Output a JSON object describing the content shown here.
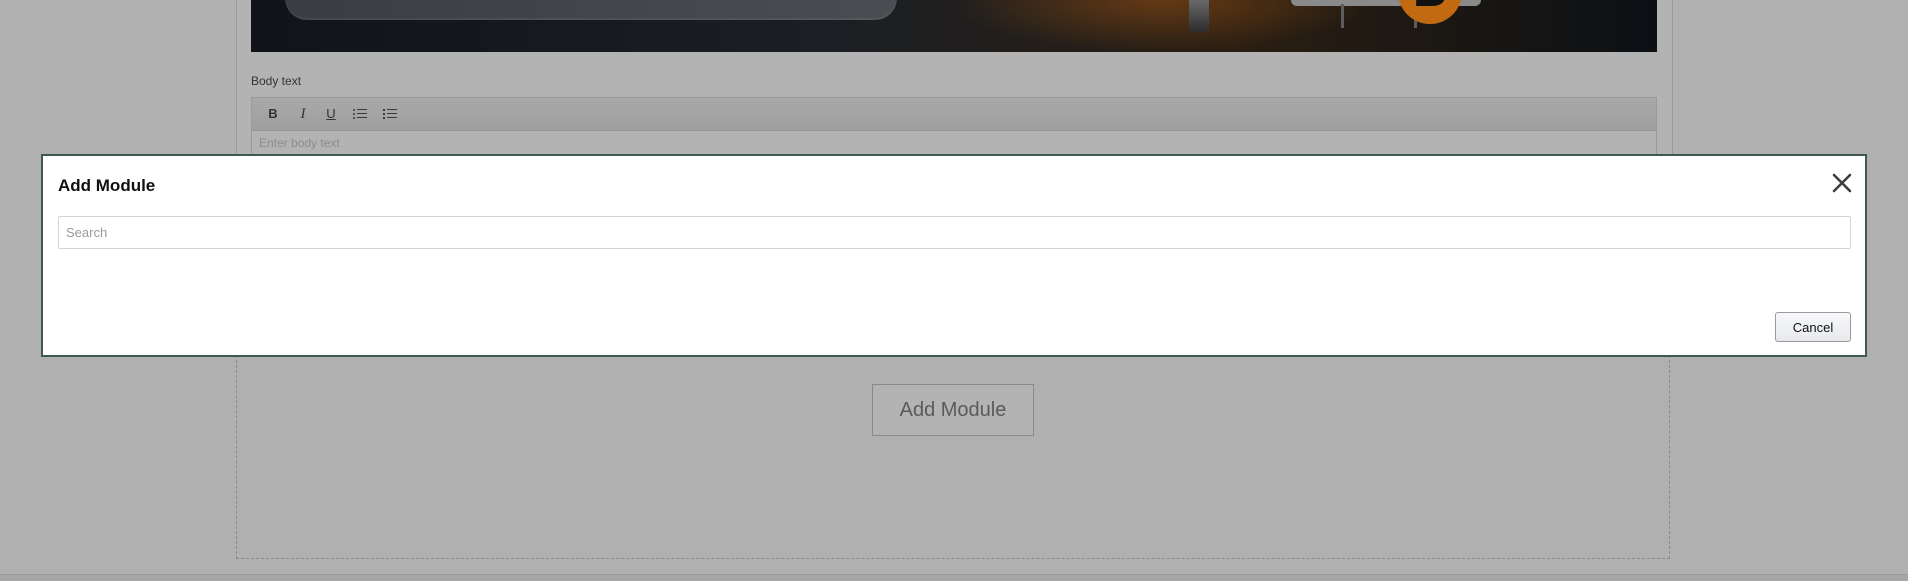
{
  "editor": {
    "body_text_label": "Body text",
    "body_text_placeholder": "Enter body text",
    "toolbar": {
      "bold": "B",
      "italic": "I",
      "underline": "U"
    }
  },
  "hero": {
    "badge_letter": "B"
  },
  "background": {
    "add_module_label": "Add Module"
  },
  "modal": {
    "title": "Add Module",
    "search_placeholder": "Search",
    "search_value": "",
    "cancel_label": "Cancel",
    "close_icon": "close-icon"
  },
  "colors": {
    "overlay": "#b3b3b3",
    "modal_border": "#3e5a4e",
    "badge": "#c26a12"
  }
}
